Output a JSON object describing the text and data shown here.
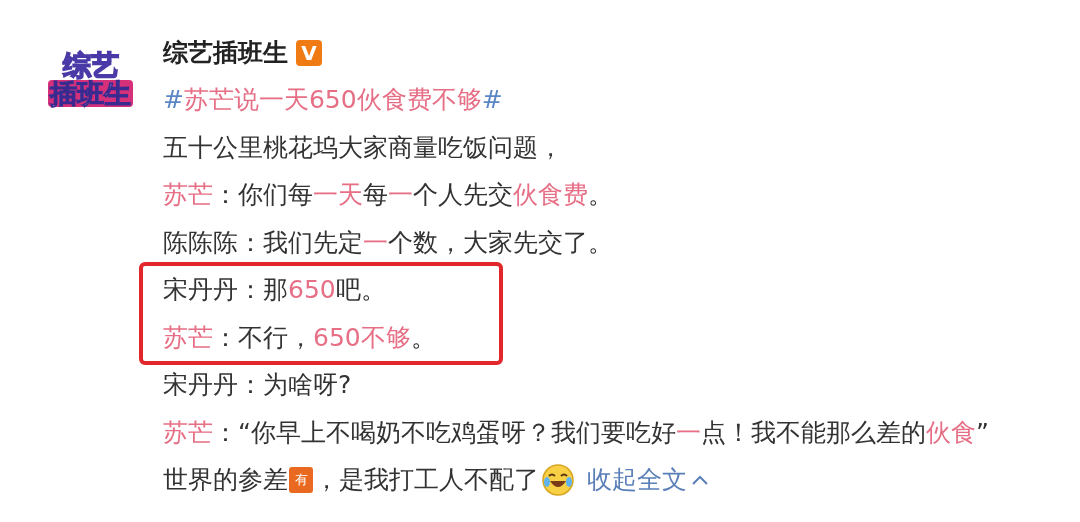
{
  "avatar": {
    "lines": [
      "综艺",
      "插班生"
    ]
  },
  "author": {
    "name": "综艺插班生",
    "badge": "V"
  },
  "hashtag": [
    {
      "text": "#",
      "highlight": false
    },
    {
      "text": "苏芒说一天650伙食费不够",
      "highlight": true
    },
    {
      "text": "#",
      "highlight": false
    }
  ],
  "lines": [
    {
      "boxed": false,
      "segments": [
        {
          "text": "五十公里桃花坞大家商量吃饭问题，",
          "highlight": false
        }
      ]
    },
    {
      "boxed": false,
      "segments": [
        {
          "text": "苏芒",
          "highlight": true
        },
        {
          "text": "：你们每",
          "highlight": false
        },
        {
          "text": "一天",
          "highlight": true
        },
        {
          "text": "每",
          "highlight": false
        },
        {
          "text": "一",
          "highlight": true
        },
        {
          "text": "个人先交",
          "highlight": false
        },
        {
          "text": "伙食费",
          "highlight": true
        },
        {
          "text": "。",
          "highlight": false
        }
      ]
    },
    {
      "boxed": false,
      "segments": [
        {
          "text": "陈陈陈：我们先定",
          "highlight": false
        },
        {
          "text": "一",
          "highlight": true
        },
        {
          "text": "个数，大家先交了。",
          "highlight": false
        }
      ]
    },
    {
      "boxed": true,
      "segments": [
        {
          "text": "宋丹丹：那",
          "highlight": false
        },
        {
          "text": "650",
          "highlight": true
        },
        {
          "text": "吧。",
          "highlight": false
        }
      ]
    },
    {
      "boxed": true,
      "segments": [
        {
          "text": "苏芒",
          "highlight": true
        },
        {
          "text": "：不行，",
          "highlight": false
        },
        {
          "text": "650不够",
          "highlight": true
        },
        {
          "text": "。",
          "highlight": false
        }
      ]
    },
    {
      "boxed": false,
      "segments": [
        {
          "text": "宋丹丹：为啥呀?",
          "highlight": false
        }
      ]
    },
    {
      "boxed": false,
      "segments": [
        {
          "text": "苏芒",
          "highlight": true
        },
        {
          "text": "：“你早上不喝奶不吃鸡蛋呀？我们要吃好",
          "highlight": false
        },
        {
          "text": "一",
          "highlight": true
        },
        {
          "text": "点！我不能那么差的",
          "highlight": false
        },
        {
          "text": "伙食",
          "highlight": true
        },
        {
          "text": "”",
          "highlight": false
        }
      ]
    }
  ],
  "last_line": {
    "text": "世界的参差",
    "sticker": "有",
    "text2": "，是我打工人不配了",
    "link": "收起全文"
  }
}
